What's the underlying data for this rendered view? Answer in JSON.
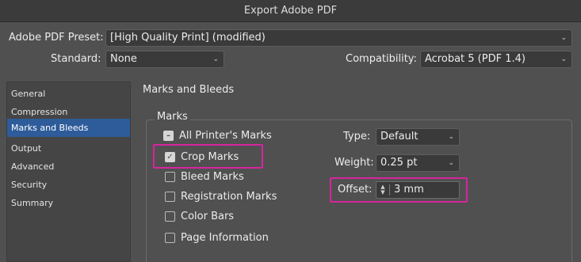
{
  "window": {
    "title": "Export Adobe PDF"
  },
  "preset": {
    "label": "Adobe PDF Preset:",
    "value": "[High Quality Print] (modified)"
  },
  "standard": {
    "label": "Standard:",
    "value": "None"
  },
  "compatibility": {
    "label": "Compatibility:",
    "value": "Acrobat 5 (PDF 1.4)"
  },
  "sidebar": {
    "items": [
      {
        "label": "General"
      },
      {
        "label": "Compression"
      },
      {
        "label": "Marks and Bleeds",
        "selected": true
      },
      {
        "label": "Output"
      },
      {
        "label": "Advanced"
      },
      {
        "label": "Security"
      },
      {
        "label": "Summary"
      }
    ]
  },
  "panel": {
    "title": "Marks and Bleeds",
    "marks_group": "Marks",
    "checkboxes": [
      {
        "label": "All Printer's Marks",
        "state": "mixed"
      },
      {
        "label": "Crop Marks",
        "state": "checked"
      },
      {
        "label": "Bleed Marks",
        "state": "unchecked"
      },
      {
        "label": "Registration Marks",
        "state": "unchecked"
      },
      {
        "label": "Color Bars",
        "state": "unchecked"
      },
      {
        "label": "Page Information",
        "state": "unchecked"
      }
    ],
    "type": {
      "label": "Type:",
      "value": "Default"
    },
    "weight": {
      "label": "Weight:",
      "value": "0.25 pt"
    },
    "offset": {
      "label": "Offset:",
      "value": "3 mm"
    }
  },
  "colors": {
    "highlight": "#d8249e",
    "selection": "#2e5c9a"
  },
  "icons": {
    "select_arrow": "chevron-down-icon",
    "spinner": "stepper-icon"
  }
}
